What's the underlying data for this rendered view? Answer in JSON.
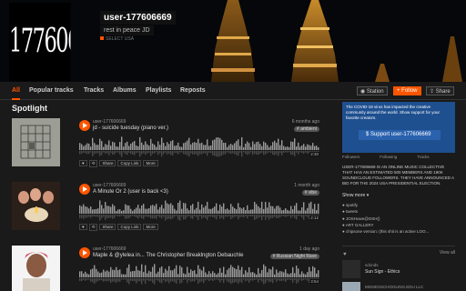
{
  "profile": {
    "avatar_text": "177606669",
    "username": "user-177606669",
    "subtitle": "rest in peace JD",
    "location": "SELECT USA"
  },
  "tabs": [
    "All",
    "Popular tracks",
    "Tracks",
    "Albums",
    "Playlists",
    "Reposts"
  ],
  "header_buttons": {
    "station": "Station",
    "follow": "Follow",
    "share": "Share"
  },
  "section_title": "Spotlight",
  "tracks": [
    {
      "artist": "user-177606669",
      "title": "jd - suicide tuesday (piano ver.)",
      "date": "6 months ago",
      "tag": "# ambient",
      "duration": "2:30",
      "actions": [
        "Share",
        "Copy Link",
        "More"
      ]
    },
    {
      "artist": "user-177606669",
      "title": "A Minute Or 2 (user is back <3)",
      "date": "1 month ago",
      "tag": "# vibe",
      "duration": "2:12",
      "actions": [
        "Share",
        "Copy Link",
        "More"
      ]
    },
    {
      "artist": "user-177606669",
      "title": "Maple & @ylelea in... The Christopher Breaklngton Debauchle",
      "date": "1 day ago",
      "tag": "# Russian Night Rave",
      "duration": "3:54",
      "actions": [
        "Share",
        "Copy Link",
        "More"
      ]
    }
  ],
  "sidebar": {
    "promo_text": "The COVID-19 virus has impacted the creative community around the world. Show support for your favorite creators.",
    "support_label": "Support user-177606669",
    "stats": [
      "Followers",
      "Following",
      "Tracks"
    ],
    "bio": "USER-177606669 IS AN ONLINE MUSIC COLLECTIVE THAT HAS AN ESTIMATED 500 MEMBERS AND 190K SOUNDCLOUD FOLLOWERS. THEY HAVE ANNOUNCED A BID FOR THE 2024 USA PRESIDENTIAL ELECTION.",
    "show_more": "Show more",
    "links": [
      "spotify",
      "tweets",
      "JOSHuwe@OSH()",
      "ART GALLERY",
      "chipsone version: (this shit is an active LOO..."
    ],
    "view_all": "View all",
    "liked": [
      {
        "user": "sd1nds",
        "title": "Sun Sign - Ethics"
      },
      {
        "user": "MISSESSCHOOLING.EDU LLC",
        "title": ""
      }
    ]
  },
  "colors": {
    "accent": "#ff5500",
    "promo": "#1e4f8f",
    "bg": "#1a1a1a"
  }
}
